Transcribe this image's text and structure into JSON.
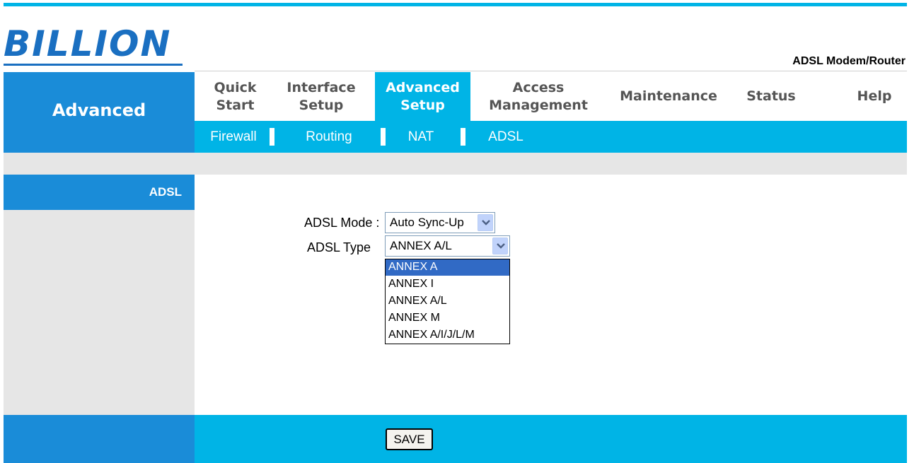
{
  "logo": {
    "text": "BILLION",
    "color": "#1a6fc1"
  },
  "product": {
    "title": "ADSL Modem/Router"
  },
  "sidebar": {
    "section_title": "Advanced",
    "active_item": "ADSL"
  },
  "main_nav": {
    "items": [
      {
        "label": "Quick\nStart",
        "active": false
      },
      {
        "label": "Interface\nSetup",
        "active": false
      },
      {
        "label": "Advanced\nSetup",
        "active": true
      },
      {
        "label": "Access\nManagement",
        "active": false
      },
      {
        "label": "Maintenance",
        "active": false
      },
      {
        "label": "Status",
        "active": false
      },
      {
        "label": "Help",
        "active": false
      }
    ]
  },
  "sub_nav": {
    "items": [
      "Firewall",
      "Routing",
      "NAT",
      "ADSL"
    ]
  },
  "form": {
    "adsl_mode": {
      "label": "ADSL Mode :",
      "value": "Auto Sync-Up"
    },
    "adsl_type": {
      "label": "ADSL Type",
      "value": "ANNEX A/L",
      "options": [
        "ANNEX A",
        "ANNEX I",
        "ANNEX A/L",
        "ANNEX M",
        "ANNEX A/I/J/L/M"
      ],
      "highlighted_option": "ANNEX A"
    }
  },
  "footer": {
    "save_label": "SAVE"
  },
  "colors": {
    "accent_cyan": "#00b4e6",
    "accent_blue": "#1a8cd8",
    "panel_gray": "#e6e6e6",
    "selection_blue": "#316ac5"
  },
  "icons": {
    "select_arrow": "chevron-down-icon"
  }
}
